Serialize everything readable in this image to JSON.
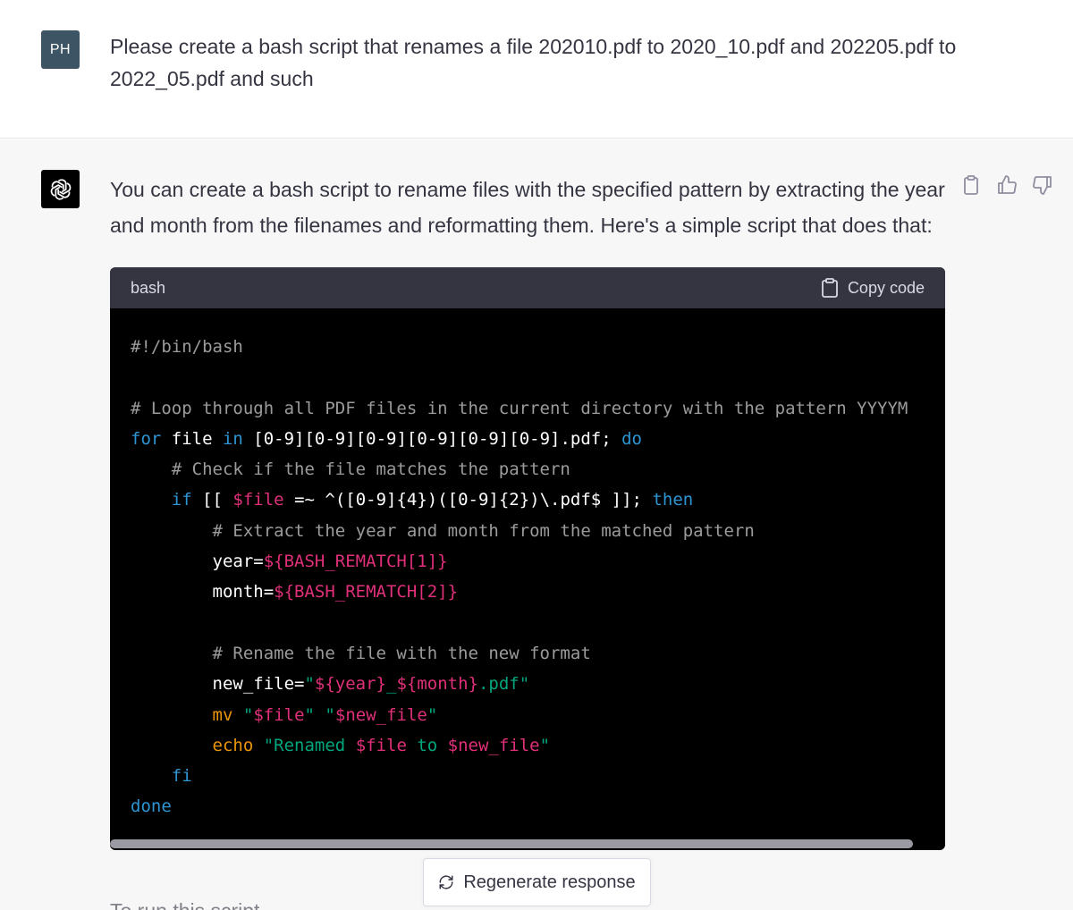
{
  "user_message": {
    "avatar_initials": "PH",
    "text": "Please create a bash script that renames a file 202010.pdf to 2020_10.pdf and 202205.pdf to 2022_05.pdf and such"
  },
  "assistant_message": {
    "avatar_icon": "openai-logo-icon",
    "intro_text": "You can create a bash script to rename files with the specified pattern by extracting the year and month from the filenames and reformatting them. Here's a simple script that does that:",
    "actions": [
      "copy-icon",
      "thumbs-up-icon",
      "thumbs-down-icon"
    ],
    "code_block": {
      "language": "bash",
      "copy_label": "Copy code",
      "lines": [
        [
          {
            "t": "#!/bin/bash",
            "c": "c-comment"
          }
        ],
        [],
        [
          {
            "t": "# Loop through all PDF files in the current directory with the pattern YYYYM",
            "c": "c-comment"
          }
        ],
        [
          {
            "t": "for",
            "c": "c-kw"
          },
          {
            "t": " file ",
            "c": "c-plain"
          },
          {
            "t": "in",
            "c": "c-kw"
          },
          {
            "t": " [0-9][0-9][0-9][0-9][0-9][0-9].pdf; ",
            "c": "c-plain"
          },
          {
            "t": "do",
            "c": "c-kw"
          }
        ],
        [
          {
            "t": "    # Check if the file matches the pattern",
            "c": "c-comment"
          }
        ],
        [
          {
            "t": "    ",
            "c": "c-plain"
          },
          {
            "t": "if",
            "c": "c-kw"
          },
          {
            "t": " [[ ",
            "c": "c-plain"
          },
          {
            "t": "$file",
            "c": "c-var"
          },
          {
            "t": " =~ ^([0-9]{4})([0-9]{2})\\.pdf$ ]]; ",
            "c": "c-plain"
          },
          {
            "t": "then",
            "c": "c-kw"
          }
        ],
        [
          {
            "t": "        # Extract the year and month from the matched pattern",
            "c": "c-comment"
          }
        ],
        [
          {
            "t": "        year=",
            "c": "c-plain"
          },
          {
            "t": "${BASH_REMATCH[1]}",
            "c": "c-var"
          }
        ],
        [
          {
            "t": "        month=",
            "c": "c-plain"
          },
          {
            "t": "${BASH_REMATCH[2]}",
            "c": "c-var"
          }
        ],
        [],
        [
          {
            "t": "        # Rename the file with the new format",
            "c": "c-comment"
          }
        ],
        [
          {
            "t": "        new_file=",
            "c": "c-plain"
          },
          {
            "t": "\"",
            "c": "c-str"
          },
          {
            "t": "${year}",
            "c": "c-var"
          },
          {
            "t": "_",
            "c": "c-str"
          },
          {
            "t": "${month}",
            "c": "c-var"
          },
          {
            "t": ".pdf\"",
            "c": "c-str"
          }
        ],
        [
          {
            "t": "        ",
            "c": "c-plain"
          },
          {
            "t": "mv",
            "c": "c-bi"
          },
          {
            "t": " ",
            "c": "c-plain"
          },
          {
            "t": "\"",
            "c": "c-str"
          },
          {
            "t": "$file",
            "c": "c-var"
          },
          {
            "t": "\"",
            "c": "c-str"
          },
          {
            "t": " ",
            "c": "c-plain"
          },
          {
            "t": "\"",
            "c": "c-str"
          },
          {
            "t": "$new_file",
            "c": "c-var"
          },
          {
            "t": "\"",
            "c": "c-str"
          }
        ],
        [
          {
            "t": "        ",
            "c": "c-plain"
          },
          {
            "t": "echo",
            "c": "c-bi"
          },
          {
            "t": " ",
            "c": "c-plain"
          },
          {
            "t": "\"Renamed ",
            "c": "c-str"
          },
          {
            "t": "$file",
            "c": "c-var"
          },
          {
            "t": " to ",
            "c": "c-str"
          },
          {
            "t": "$new_file",
            "c": "c-var"
          },
          {
            "t": "\"",
            "c": "c-str"
          }
        ],
        [
          {
            "t": "    ",
            "c": "c-plain"
          },
          {
            "t": "fi",
            "c": "c-kw"
          }
        ],
        [
          {
            "t": "done",
            "c": "c-kw"
          }
        ]
      ]
    }
  },
  "regenerate_button": {
    "label": "Regenerate response",
    "icon": "refresh-icon"
  },
  "trailing_text": "To run this script"
}
